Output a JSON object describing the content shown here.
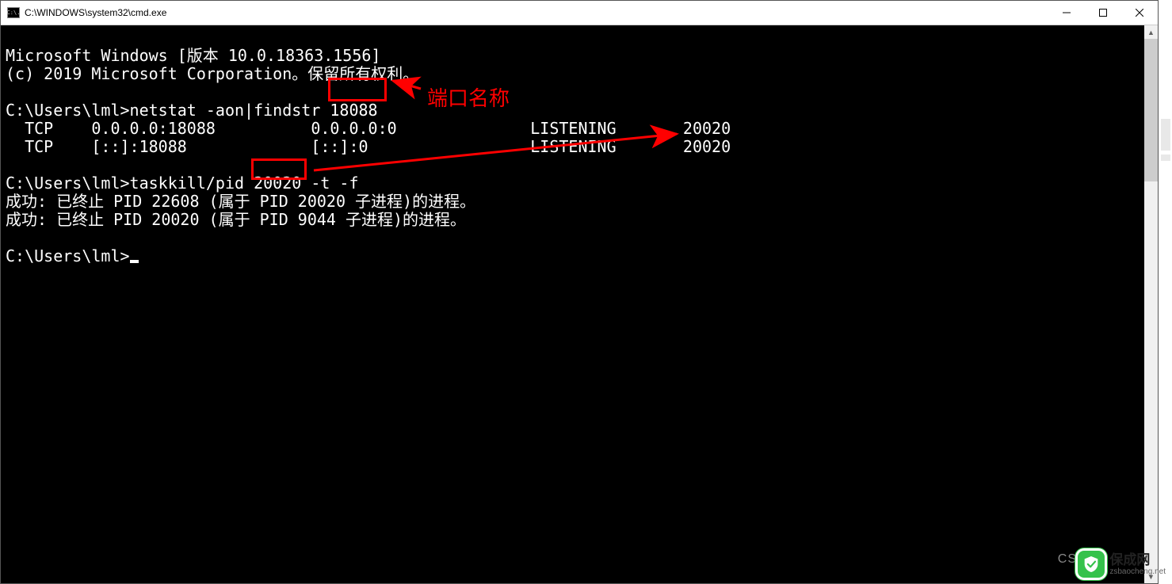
{
  "window": {
    "title": "C:\\WINDOWS\\system32\\cmd.exe",
    "icon_label": "C:\\."
  },
  "terminal": {
    "lines": {
      "l0": "Microsoft Windows [版本 10.0.18363.1556]",
      "l1": "(c) 2019 Microsoft Corporation。保留所有权利。",
      "l2": "",
      "l3": "C:\\Users\\lml>netstat -aon|findstr 18088",
      "l4": "  TCP    0.0.0.0:18088          0.0.0.0:0              LISTENING       20020",
      "l5": "  TCP    [::]:18088             [::]:0                 LISTENING       20020",
      "l6": "",
      "l7": "C:\\Users\\lml>taskkill/pid 20020 -t -f",
      "l8": "成功: 已终止 PID 22608 (属于 PID 20020 子进程)的进程。",
      "l9": "成功: 已终止 PID 20020 (属于 PID 9044 子进程)的进程。",
      "l10": "",
      "l11": "C:\\Users\\lml>"
    }
  },
  "annotations": {
    "port_label": "端口名称",
    "box1_target": "18088",
    "box2_target": "20020"
  },
  "watermark": {
    "name": "保成网",
    "domain": "zsbaocheng.net",
    "side_text": "CS"
  }
}
